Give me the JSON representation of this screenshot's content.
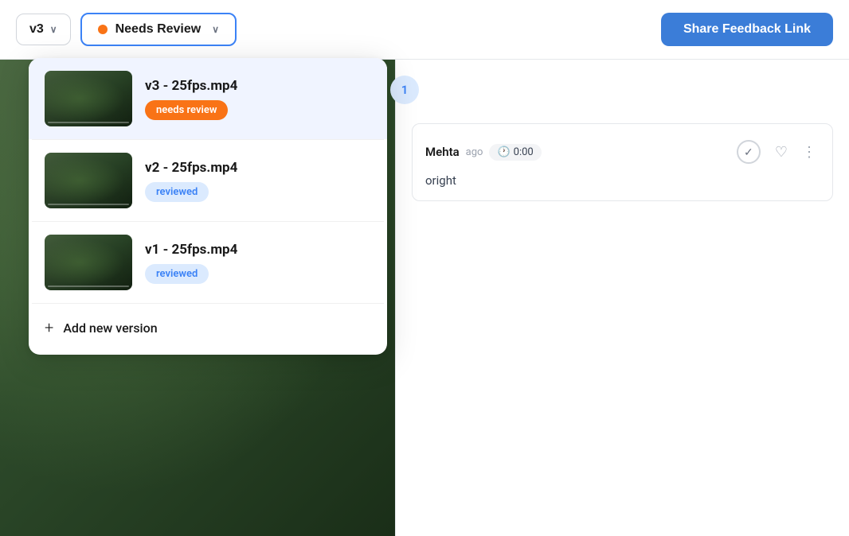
{
  "header": {
    "version_label": "v3",
    "version_chevron": "∨",
    "status_label": "Needs Review",
    "status_chevron": "∨",
    "status_color": "#f97316",
    "share_button_label": "Share Feedback Link"
  },
  "dropdown": {
    "items": [
      {
        "id": "v3",
        "name": "v3 - 25fps.mp4",
        "badge_label": "needs review",
        "badge_type": "needs-review",
        "active": true
      },
      {
        "id": "v2",
        "name": "v2 - 25fps.mp4",
        "badge_label": "reviewed",
        "badge_type": "reviewed",
        "active": false
      },
      {
        "id": "v1",
        "name": "v1 - 25fps.mp4",
        "badge_label": "reviewed",
        "badge_type": "reviewed",
        "active": false
      }
    ],
    "add_version_label": "Add new version"
  },
  "notification_badge": "1",
  "comment": {
    "author": "Mehta",
    "time_ago": "ago",
    "timestamp": "0:00",
    "text": "oright",
    "check_icon": "✓",
    "heart_icon": "♡",
    "more_icon": "⋮"
  }
}
